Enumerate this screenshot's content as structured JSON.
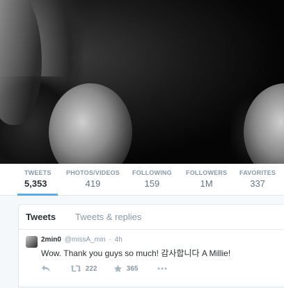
{
  "profile_nav": {
    "stats": [
      {
        "label": "TWEETS",
        "value": "5,353",
        "active": true
      },
      {
        "label": "PHOTOS/VIDEOS",
        "value": "419"
      },
      {
        "label": "FOLLOWING",
        "value": "159"
      },
      {
        "label": "FOLLOWERS",
        "value": "1M"
      },
      {
        "label": "FAVORITES",
        "value": "337"
      }
    ],
    "accent_color": "#55acee"
  },
  "timeline": {
    "tabs": [
      {
        "label": "Tweets",
        "active": true
      },
      {
        "label": "Tweets & replies"
      }
    ],
    "tweet": {
      "name": "2min0",
      "handle": "@missA_min",
      "separator": "·",
      "time": "4h",
      "text": "Wow. Thank you guys so much! 감사합니다 A Millie!",
      "retweet_count": "222",
      "favorite_count": "365",
      "icons": [
        "reply-icon",
        "retweet-icon",
        "favorite-icon",
        "more-icon"
      ]
    }
  }
}
